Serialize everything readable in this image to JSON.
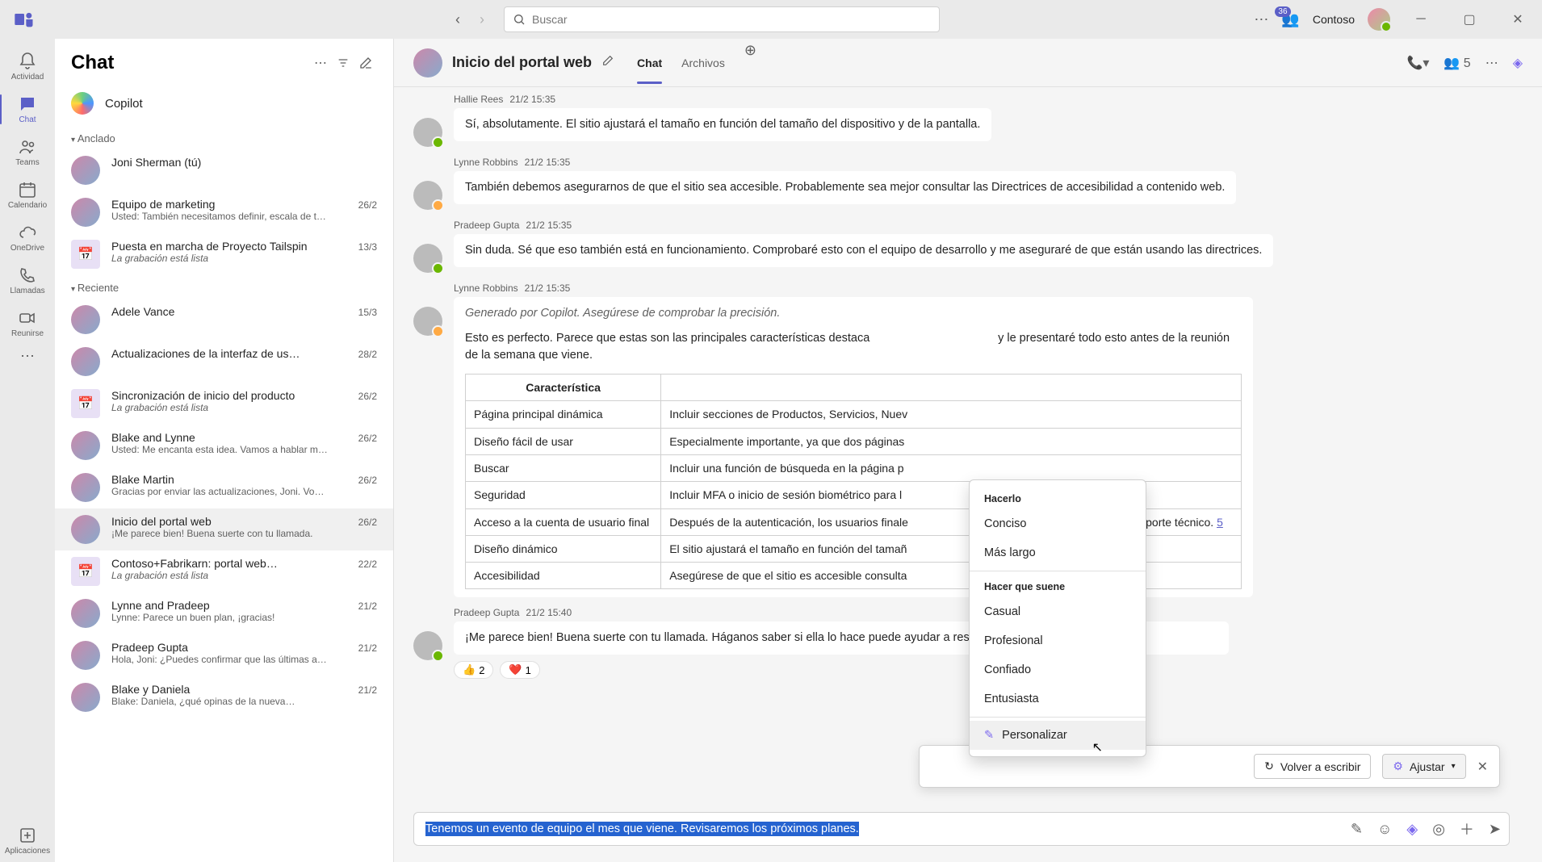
{
  "titlebar": {
    "search_placeholder": "Buscar",
    "org_name": "Contoso",
    "notif_count": "36"
  },
  "rail": {
    "activity": "Actividad",
    "chat": "Chat",
    "teams": "Teams",
    "calendar": "Calendario",
    "onedrive": "OneDrive",
    "calls": "Llamadas",
    "meet": "Reunirse",
    "apps": "Aplicaciones"
  },
  "chatlist": {
    "title": "Chat",
    "copilot": "Copilot",
    "sections": {
      "pinned": "Anclado",
      "recent": "Reciente"
    },
    "pinned": [
      {
        "title": "Joni Sherman (tú)",
        "preview": "",
        "date": ""
      },
      {
        "title": "Equipo de marketing",
        "preview": "Usted: También necesitamos definir, escala de t…",
        "date": "26/2"
      },
      {
        "title": "Puesta en marcha de Proyecto Tailspin",
        "preview": "La grabación está lista",
        "date": "13/3",
        "italic": true,
        "cal": true
      }
    ],
    "recent": [
      {
        "title": "Adele Vance",
        "preview": "",
        "date": "15/3"
      },
      {
        "title": "Actualizaciones de la interfaz de us…",
        "preview": "",
        "date": "28/2"
      },
      {
        "title": "Sincronización de inicio del producto",
        "preview": "La grabación está lista",
        "date": "26/2",
        "italic": true,
        "cal": true
      },
      {
        "title": "Blake and Lynne",
        "preview": "Usted: Me encanta esta idea. Vamos a hablar m…",
        "date": "26/2"
      },
      {
        "title": "Blake Martin",
        "preview": "Gracias por enviar las actualizaciones, Joni. Vo…",
        "date": "26/2"
      },
      {
        "title": "Inicio del portal web",
        "preview": "¡Me parece bien! Buena suerte con tu llamada.",
        "date": "26/2",
        "selected": true
      },
      {
        "title": "Contoso+Fabrikarn: portal web…",
        "preview": "La grabación está lista",
        "date": "22/2",
        "italic": true,
        "cal": true
      },
      {
        "title": "Lynne and Pradeep",
        "preview": "Lynne: Parece un buen plan, ¡gracias!",
        "date": "21/2"
      },
      {
        "title": "Pradeep Gupta",
        "preview": "Hola, Joni: ¿Puedes confirmar que las últimas a…",
        "date": "21/2"
      },
      {
        "title": "Blake y Daniela",
        "preview": "Blake: Daniela, ¿qué opinas de la nueva…",
        "date": "21/2"
      }
    ]
  },
  "conv": {
    "title": "Inicio del portal web",
    "tabs": {
      "chat": "Chat",
      "files": "Archivos"
    },
    "people_count": "5",
    "messages": [
      {
        "author": "Hallie Rees",
        "ts": "21/2 15:35",
        "text": "Sí, absolutamente. El sitio ajustará el tamaño en función del tamaño del dispositivo y de la pantalla."
      },
      {
        "author": "Lynne Robbins",
        "ts": "21/2 15:35",
        "text": "También debemos asegurarnos de que el sitio sea accesible. Probablemente sea mejor consultar las Directrices de accesibilidad a contenido web."
      },
      {
        "author": "Pradeep Gupta",
        "ts": "21/2 15:35",
        "text": "Sin duda. Sé que eso también está en funcionamiento. Comprobaré esto con el equipo de desarrollo y me aseguraré de que están usando las directrices."
      }
    ],
    "copilot_msg": {
      "author": "Lynne Robbins",
      "ts": "21/2 15:35",
      "note": "Generado por Copilot. Asegúrese de comprobar la precisión.",
      "body_before": "Esto es perfecto. Parece que estas son las principales características destaca",
      "body_after": " y le presentaré todo esto antes de la reunión de la semana que viene.",
      "table_header": "Característica",
      "rows": [
        {
          "f": "Página principal dinámica",
          "d": "Incluir secciones de Productos, Servicios, Nuev"
        },
        {
          "f": "Diseño fácil de usar",
          "d": "Especialmente importante, ya que dos páginas "
        },
        {
          "f": "Buscar",
          "d": "Incluir una función de búsqueda en la página p"
        },
        {
          "f": "Seguridad",
          "d": "Incluir MFA o inicio de sesión biométrico para l"
        },
        {
          "f": "Acceso a la cuenta de usuario final",
          "d_pre": "Después de la autenticación, los usuarios finale",
          "d_post": " Órdenes, facturas y vales de soporte técnico. ",
          "link": "5"
        },
        {
          "f": "Diseño dinámico",
          "d": "El sitio ajustará el tamaño en función del tamañ"
        },
        {
          "f": "Accesibilidad",
          "d": "Asegúrese de que el sitio es accesible consulta"
        }
      ]
    },
    "reply": {
      "author": "Pradeep Gupta",
      "ts": "21/2 15:40",
      "text": "¡Me parece bien! Buena suerte con tu llamada. Háganos saber si ella lo hace                                   puede ayudar a responder antes de la reunión local.",
      "reactions": [
        {
          "emoji": "👍",
          "count": "2"
        },
        {
          "emoji": "❤️",
          "count": "1"
        }
      ]
    },
    "rewrite": {
      "rewrite_label": "Volver a escribir",
      "adjust_label": "Ajustar"
    },
    "adjust_menu": {
      "section1": "Hacerlo",
      "concise": "Conciso",
      "longer": "Más largo",
      "section2": "Hacer que suene",
      "casual": "Casual",
      "professional": "Profesional",
      "confident": "Confiado",
      "enthusiastic": "Entusiasta",
      "custom": "Personalizar"
    },
    "compose_text": "Tenemos un evento de equipo el mes que viene. Revisaremos los próximos planes."
  }
}
